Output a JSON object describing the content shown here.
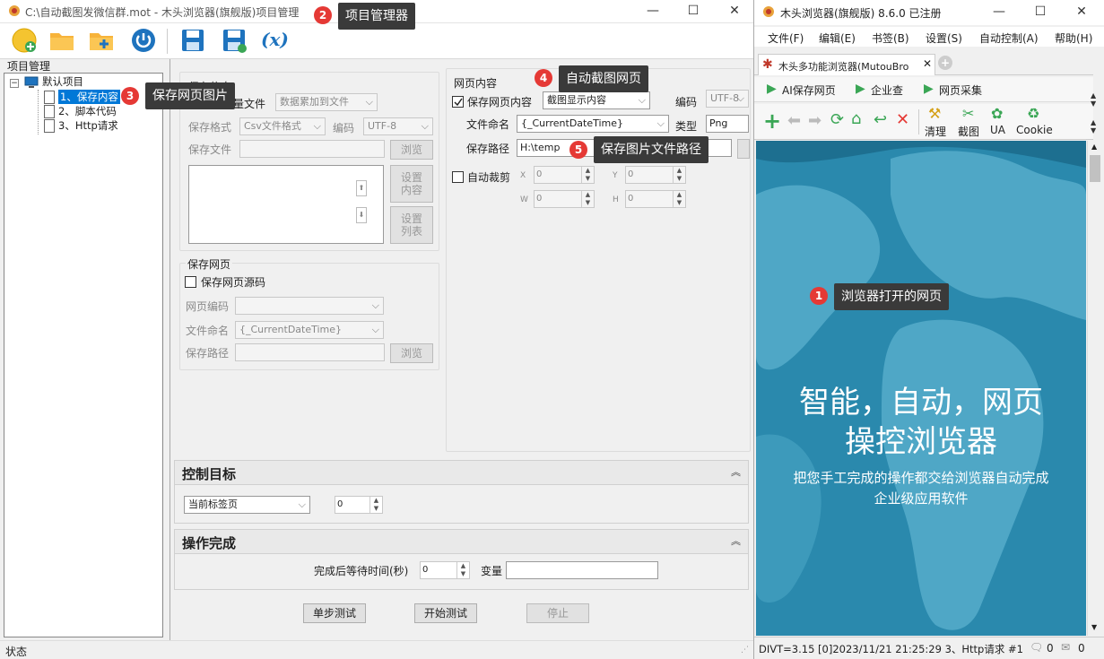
{
  "left_window": {
    "title": "C:\\自动截图发微信群.mot  - 木头浏览器(旗舰版)项目管理"
  },
  "tree": {
    "label": "项目管理",
    "root": "默认项目",
    "items": [
      "1、保存内容",
      "2、脚本代码",
      "3、Http请求"
    ]
  },
  "save_info": {
    "legend": "保存信息",
    "batch_checkbox_label": "保存批量文件",
    "mode_select": "数据累加到文件",
    "format_label": "保存格式",
    "format_value": "Csv文件格式",
    "encoding_label": "编码",
    "encoding_value": "UTF-8",
    "file_label": "保存文件",
    "browse": "浏览",
    "set_content": "设置内容",
    "set_columns": "设置列表"
  },
  "save_page": {
    "legend": "保存网页",
    "source_checkbox": "保存网页源码",
    "encoding_label": "网页编码",
    "naming_label": "文件命名",
    "naming_value": "{_CurrentDateTime}",
    "path_label": "保存路径",
    "browse": "浏览"
  },
  "web_content": {
    "legend": "网页内容",
    "save_checkbox": "保存网页内容",
    "mode_select": "截图显示内容",
    "encoding_label": "编码",
    "encoding_value": "UTF-8",
    "naming_label": "文件命名",
    "naming_value": "{_CurrentDateTime}",
    "type_label": "类型",
    "type_value": "Png",
    "path_label": "保存路径",
    "path_value": "H:\\temp",
    "crop_checkbox": "自动裁剪",
    "x_label": "X",
    "y_label": "Y",
    "w_label": "W",
    "h_label": "H",
    "x": "0",
    "y": "0",
    "w": "0",
    "h": "0"
  },
  "control_target": {
    "title": "控制目标",
    "select": "当前标签页",
    "index": "0"
  },
  "operation_done": {
    "title": "操作完成",
    "wait_label": "完成后等待时间(秒)",
    "wait_value": "0",
    "var_label": "变量"
  },
  "actions": {
    "step": "单步测试",
    "start": "开始测试",
    "stop": "停止"
  },
  "status_left": "状态",
  "browser": {
    "title": "木头浏览器(旗舰版) 8.6.0  已注册",
    "menu": [
      "文件(F)",
      "编辑(E)",
      "书签(B)",
      "设置(S)",
      "自动控制(A)",
      "帮助(H)"
    ],
    "tab": "木头多功能浏览器(MutouBro",
    "bookmarks": [
      "AI保存网页",
      "企业查",
      "网页采集"
    ],
    "tools": [
      "清理",
      "截图",
      "UA",
      "Cookie"
    ],
    "hero_line1": "智能，自动，网页",
    "hero_line2": "操控浏览器",
    "sub_line1": "把您手工完成的操作都交给浏览器自动完成",
    "sub_line2": "企业级应用软件",
    "status": "DIVT=3.15  [0]2023/11/21 21:25:29 3、Http请求 #1",
    "count1": "0",
    "count2": "0"
  },
  "callouts": [
    {
      "num": "1",
      "text": "浏览器打开的网页"
    },
    {
      "num": "2",
      "text": "项目管理器"
    },
    {
      "num": "3",
      "text": "保存网页图片"
    },
    {
      "num": "4",
      "text": "自动截图网页"
    },
    {
      "num": "5",
      "text": "保存图片文件路径"
    }
  ]
}
